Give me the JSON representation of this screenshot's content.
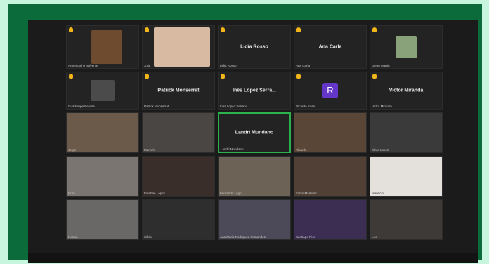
{
  "meeting": {
    "row1": [
      {
        "name": "",
        "caption": "Armengolhe nalvente"
      },
      {
        "name": "",
        "caption": "Julia"
      },
      {
        "name": "Lidia Rosso",
        "caption": "Lidia Rosso"
      },
      {
        "name": "Ana Carla",
        "caption": "Ana Carla"
      },
      {
        "name": "",
        "caption": "Diego Martin"
      }
    ],
    "row2": [
      {
        "name": "",
        "caption": "Guadalupe Pereira"
      },
      {
        "name": "Patrick Monserrat",
        "caption": "Patrick Monserrat"
      },
      {
        "name": "Inés Lopez Serra...",
        "caption": "Inés Lopez Serrano"
      },
      {
        "name": "R",
        "caption": "Ricardo Sosa"
      },
      {
        "name": "Victor Miranda",
        "caption": "Victor Miranda"
      }
    ],
    "video_tiles": [
      {
        "caption": "Jorge"
      },
      {
        "caption": "Marcelo"
      },
      {
        "name": "Landri Mundano",
        "caption": "Landri Mundano"
      },
      {
        "caption": "Ricardo"
      },
      {
        "caption": "Silvia Lopez"
      },
      {
        "caption": "Nora"
      },
      {
        "caption": "Esteban Lopez"
      },
      {
        "caption": "Fernanda Lago"
      },
      {
        "caption": "Fabio Martinez"
      },
      {
        "caption": "Mauricio"
      },
      {
        "caption": "Norma"
      },
      {
        "caption": "Silvia"
      },
      {
        "caption": "Ana Maria Rodriguez Fernandez"
      },
      {
        "caption": "Santiago Rios"
      },
      {
        "caption": "Leo"
      }
    ]
  },
  "colors": {
    "frame": "#0b6b3a",
    "background": "#c8f5dd",
    "active_speaker": "#2db14d",
    "hand": "#f2b51a",
    "avatar_r": "#6437c8"
  }
}
